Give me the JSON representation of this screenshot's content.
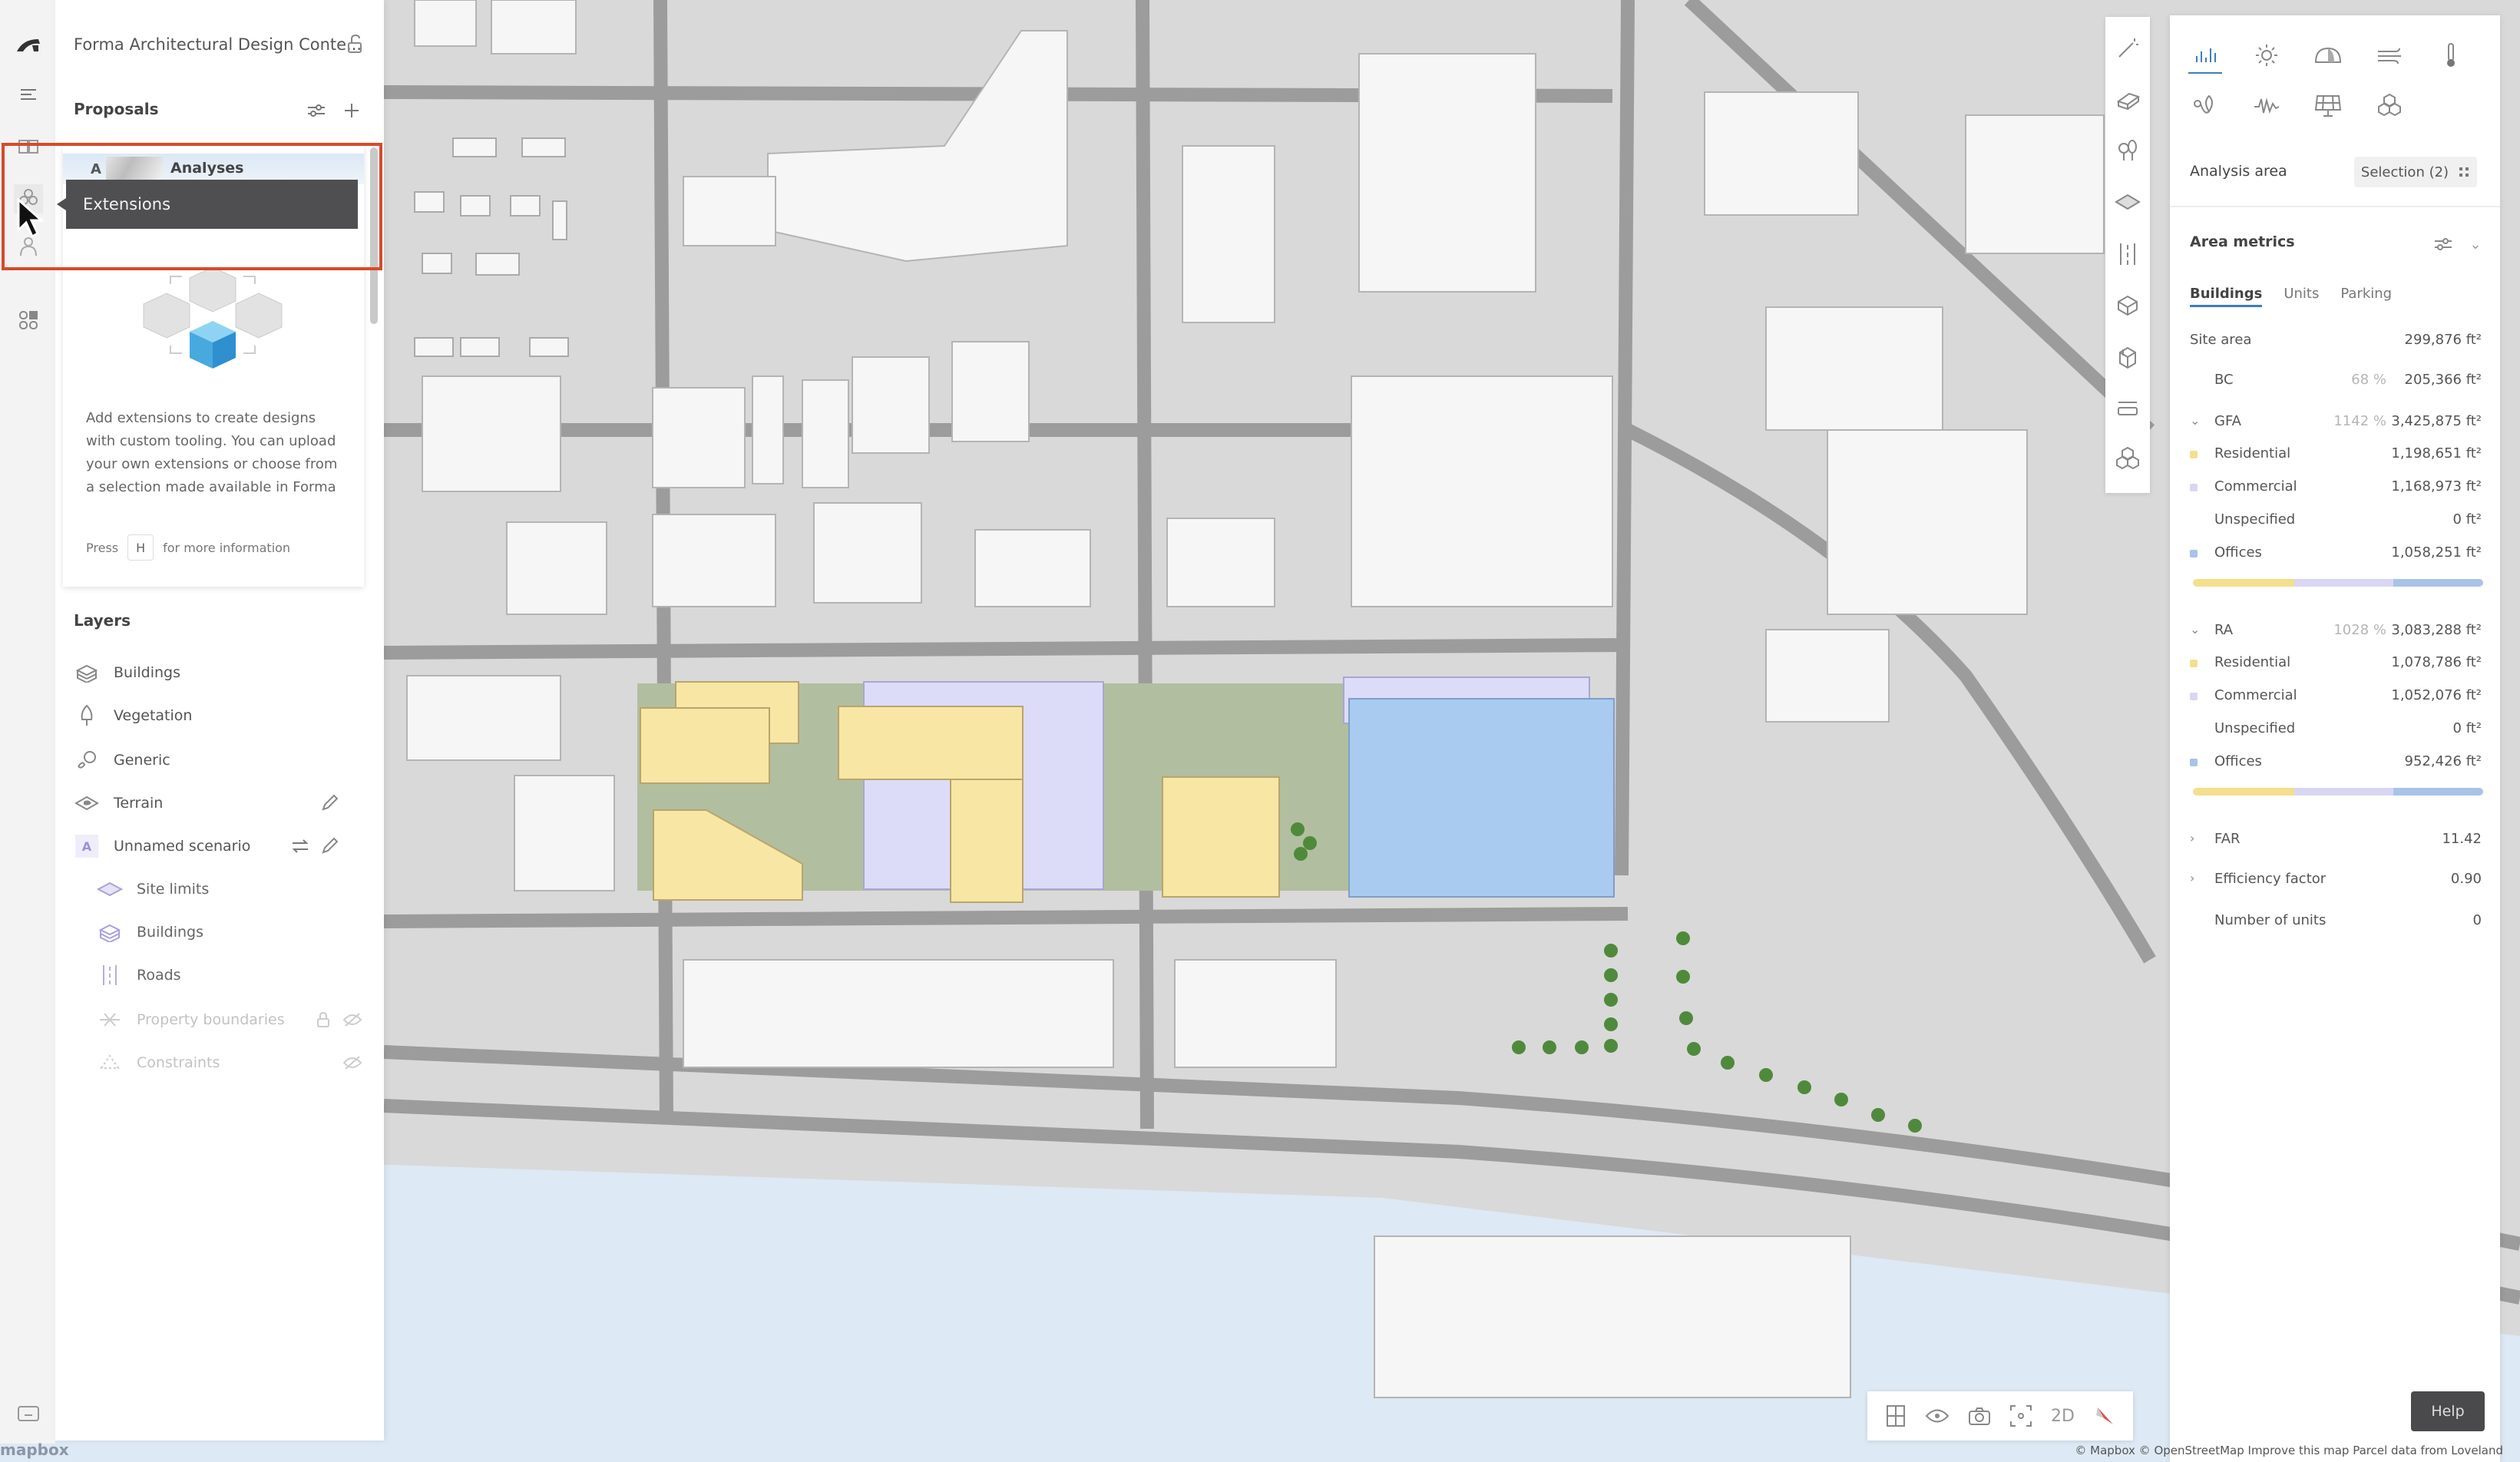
{
  "app": {
    "project_title": "Forma Architectural Design Conte...",
    "logo_icon": "forma-logo-icon",
    "lock_icon": "unlock-icon"
  },
  "rail": {
    "items": [
      {
        "icon": "menu-icon"
      },
      {
        "icon": "book-icon"
      },
      {
        "icon": "extensions-icon",
        "active": true
      },
      {
        "icon": "collaborators-icon"
      },
      {
        "icon": "apps-grid-icon"
      },
      {
        "icon": "keyboard-icon"
      }
    ]
  },
  "proposals": {
    "title": "Proposals",
    "filter_icon": "sliders-icon",
    "add_icon": "plus-icon",
    "active_proposal": {
      "badge": "A",
      "label": "Analyses"
    },
    "tooltip": "Extensions",
    "extensions_description": "Add extensions to create designs with custom tooling. You can upload your own extensions or choose from a selection made available in Forma",
    "press_prefix": "Press",
    "press_key": "H",
    "press_suffix": "for more information"
  },
  "layers": {
    "title": "Layers",
    "items": [
      {
        "label": "Buildings",
        "icon": "buildings-icon",
        "level": 0
      },
      {
        "label": "Vegetation",
        "icon": "tree-icon",
        "level": 0
      },
      {
        "label": "Generic",
        "icon": "generic-icon",
        "level": 0
      },
      {
        "label": "Terrain",
        "icon": "terrain-icon",
        "level": 0,
        "actions": [
          "edit"
        ]
      },
      {
        "label": "Unnamed scenario",
        "icon": "scenario-badge",
        "badge": "A",
        "level": 0,
        "actions": [
          "swap",
          "edit"
        ]
      },
      {
        "label": "Site limits",
        "icon": "site-limits-icon",
        "level": 1
      },
      {
        "label": "Buildings",
        "icon": "buildings-icon",
        "level": 1
      },
      {
        "label": "Roads",
        "icon": "roads-icon",
        "level": 1
      },
      {
        "label": "Property boundaries",
        "icon": "property-boundaries-icon",
        "level": 1,
        "dimmed": true,
        "actions": [
          "lock",
          "hidden"
        ]
      },
      {
        "label": "Constraints",
        "icon": "constraints-icon",
        "level": 1,
        "dimmed": true,
        "actions": [
          "hidden"
        ]
      }
    ]
  },
  "design_toolbar": {
    "tools": [
      "magic-wand-icon",
      "building-tool-icon",
      "vegetation-tool-icon",
      "zone-tool-icon",
      "road-tool-icon",
      "box-tool-icon",
      "import-model-icon",
      "measure-icon",
      "extensions-tool-icon"
    ]
  },
  "analysis": {
    "analysis_icons": [
      "area-metrics-icon",
      "sun-hours-icon",
      "daylight-icon",
      "wind-icon",
      "microclimate-icon",
      "embodied-carbon-icon",
      "noise-icon",
      "solar-energy-icon",
      "extensions-analysis-icon"
    ],
    "analysis_area_label": "Analysis area",
    "selection_label": "Selection (2)",
    "area_metrics_title": "Area metrics",
    "tabs": [
      "Buildings",
      "Units",
      "Parking"
    ],
    "active_tab": "Buildings",
    "site_area": {
      "label": "Site area",
      "value": "299,876 ft²"
    },
    "bc": {
      "label": "BC",
      "percent": "68 %",
      "value": "205,366 ft²"
    },
    "gfa": {
      "label": "GFA",
      "percent": "1142 %",
      "value": "3,425,875 ft²",
      "items": [
        {
          "label": "Residential",
          "value": "1,198,651 ft²",
          "color": "#f3df8e"
        },
        {
          "label": "Commercial",
          "value": "1,168,973 ft²",
          "color": "#d9d6f3"
        },
        {
          "label": "Unspecified",
          "value": "0 ft²",
          "color": "#ffffff"
        },
        {
          "label": "Offices",
          "value": "1,058,251 ft²",
          "color": "#a9c3e6"
        }
      ]
    },
    "ra": {
      "label": "RA",
      "percent": "1028 %",
      "value": "3,083,288 ft²",
      "items": [
        {
          "label": "Residential",
          "value": "1,078,786 ft²",
          "color": "#f3df8e"
        },
        {
          "label": "Commercial",
          "value": "1,052,076 ft²",
          "color": "#d9d6f3"
        },
        {
          "label": "Unspecified",
          "value": "0 ft²",
          "color": "#ffffff"
        },
        {
          "label": "Offices",
          "value": "952,426 ft²",
          "color": "#a9c3e6"
        }
      ]
    },
    "gfa_bar_fractions": [
      0.35,
      0.34,
      0.0,
      0.31
    ],
    "ra_bar_fractions": [
      0.35,
      0.34,
      0.0,
      0.31
    ],
    "far": {
      "label": "FAR",
      "value": "11.42"
    },
    "efficiency": {
      "label": "Efficiency factor",
      "value": "0.90"
    },
    "units": {
      "label": "Number of units",
      "value": "0"
    }
  },
  "bottom_toolbar": {
    "items": [
      "floorplan-icon",
      "visibility-icon",
      "camera-icon",
      "focus-icon",
      "2D",
      "compass-icon"
    ],
    "mode_label": "2D",
    "help_label": "Help"
  },
  "attribution": "© Mapbox © OpenStreetMap Improve this map Parcel data from Loveland",
  "mapbox_logo": "mapbox",
  "colors": {
    "residential": "#f3df8e",
    "commercial": "#d9d6f3",
    "offices": "#a9c3e6",
    "site_green": "#b2bea0",
    "highlight": "#d84a2a",
    "accent": "#3a7ebf"
  }
}
